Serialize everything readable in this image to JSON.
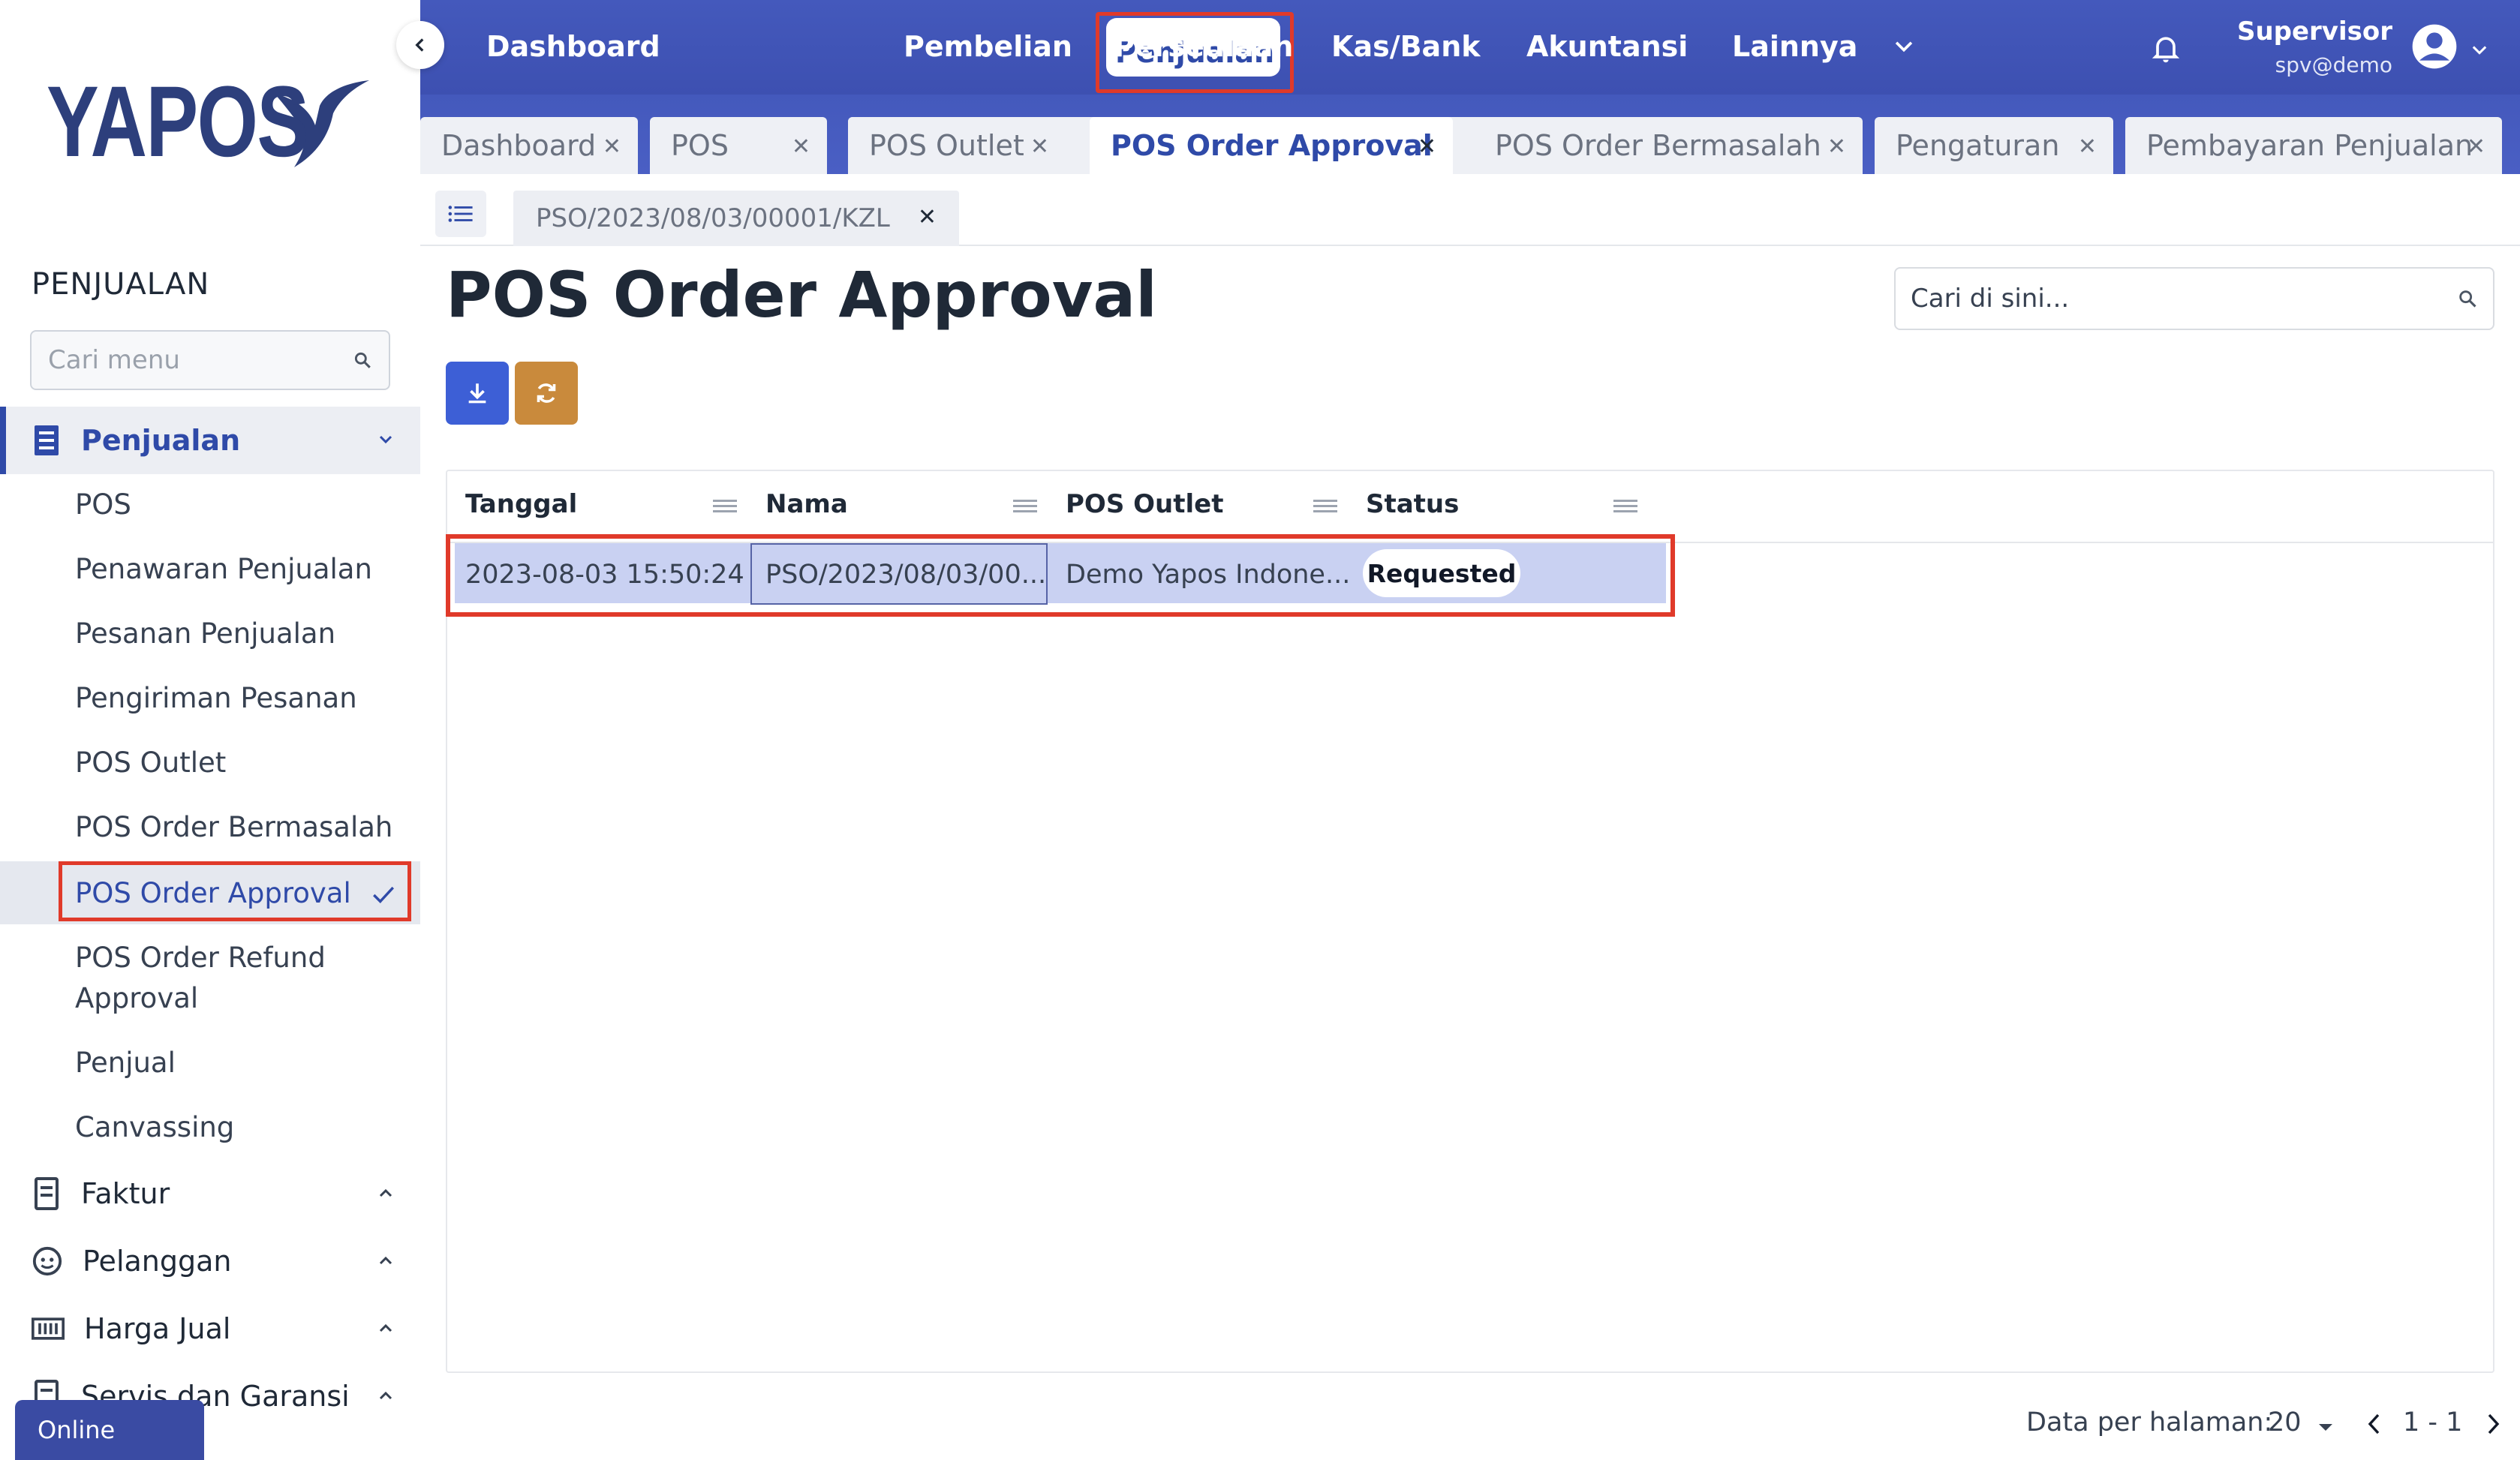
{
  "brand": {
    "name": "YAPOS"
  },
  "sidebar": {
    "title": "PENJUALAN",
    "search_placeholder": "Cari menu",
    "section_active": "Penjualan",
    "items": [
      "POS",
      "Penawaran Penjualan",
      "Pesanan Penjualan",
      "Pengiriman Pesanan",
      "POS Outlet",
      "POS Order Bermasalah",
      "POS Order Approval",
      "POS Order Refund",
      "Approval",
      "Penjual",
      "Canvassing"
    ],
    "sections": [
      "Faktur",
      "Pelanggan",
      "Harga Jual",
      "Servis dan Garansi"
    ],
    "online_label": "Online"
  },
  "topnav": {
    "items": [
      "Dashboard",
      "Penjualan",
      "Pembelian",
      "Persediaan",
      "Kas/Bank",
      "Akuntansi",
      "Lainnya"
    ],
    "user_name": "Supervisor",
    "user_email": "spv@demo"
  },
  "tabs": [
    "Dashboard",
    "POS",
    "POS Outlet",
    "POS Order Approval",
    "POS Order Bermasalah",
    "Pengaturan",
    "Pembayaran Penjualan"
  ],
  "subtab": {
    "doc": "PSO/2023/08/03/00001/KZL"
  },
  "page": {
    "title": "POS Order Approval",
    "search_placeholder": "Cari di sini..."
  },
  "table": {
    "columns": [
      "Tanggal",
      "Nama",
      "POS Outlet",
      "Status"
    ],
    "rows": [
      {
        "tanggal": "2023-08-03 15:50:24",
        "nama": "PSO/2023/08/03/00...",
        "outlet": "Demo Yapos Indone...",
        "status": "Requested"
      }
    ]
  },
  "pager": {
    "label": "Data per halaman:",
    "size": "20",
    "range": "1 - 1"
  },
  "colors": {
    "primary": "#3f51b5",
    "accent": "#2f4aa8",
    "highlight": "#e03a2a",
    "refresh": "#c98a3c"
  }
}
